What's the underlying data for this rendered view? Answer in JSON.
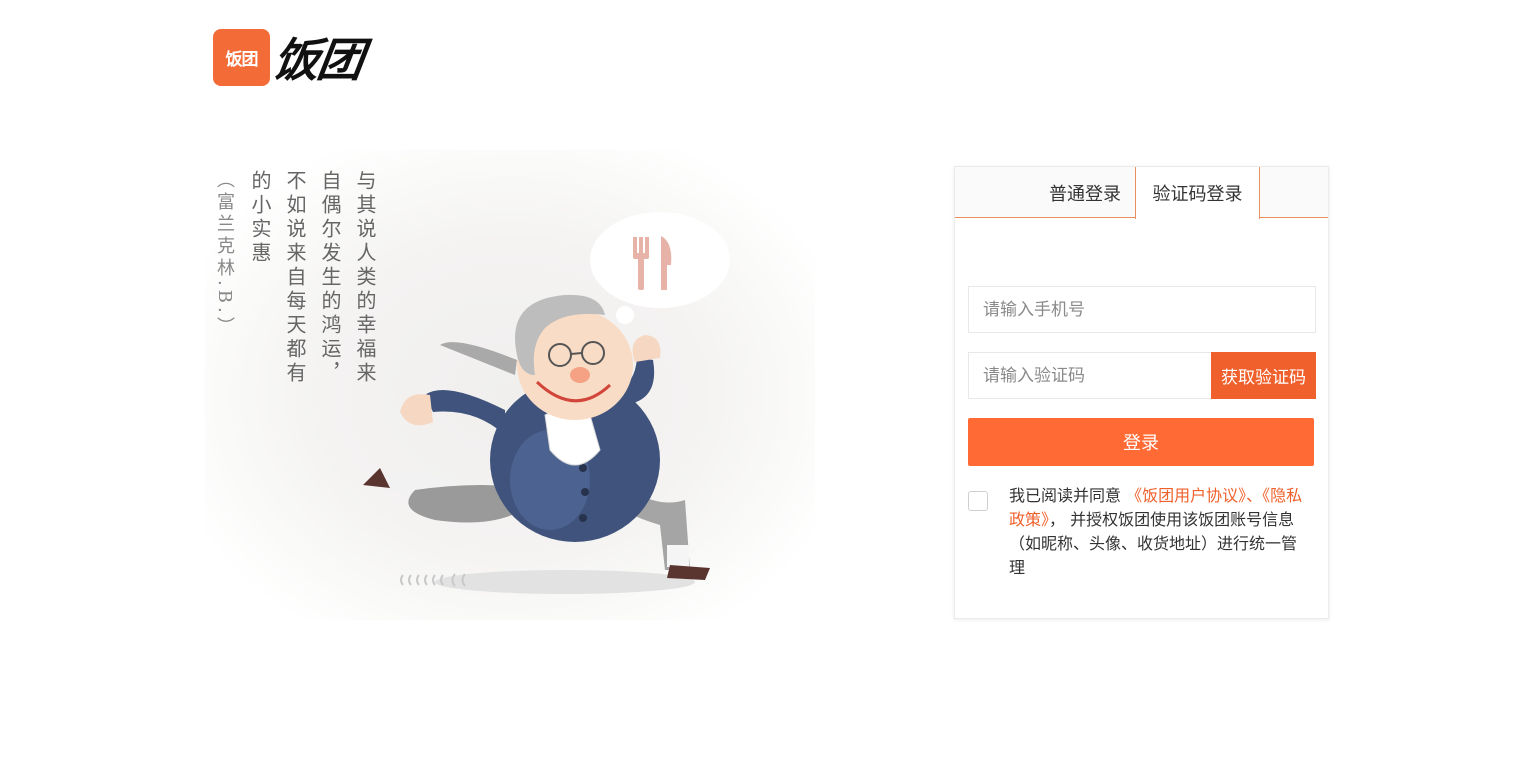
{
  "logo": {
    "badge_text": "饭团",
    "brand_text": "饭团",
    "brand_color": "#f36b36"
  },
  "illustration": {
    "quote_lines": [
      "与其说人类的幸福来",
      "自偶尔发生的鸿运，",
      "不如说来自每天都有",
      "的小实惠"
    ],
    "quote_highlight_color": "#b4442e",
    "attribution": "（富兰克林.B.）",
    "bubble_icon": "fork-knife-icon"
  },
  "login": {
    "tabs": [
      {
        "label": "普通登录",
        "active": false
      },
      {
        "label": "验证码登录",
        "active": true
      }
    ],
    "phone_placeholder": "请输入手机号",
    "code_placeholder": "请输入验证码",
    "get_code_label": "获取验证码",
    "submit_label": "登录",
    "accent_color": "#ff6a35",
    "agreement": {
      "prefix": "我已阅读并同意 ",
      "user_agreement": "《饭团用户协议》",
      "separator": "、",
      "privacy_policy": "《隐私政策》",
      "suffix": "， 并授权饭团使用该饭团账号信息（如昵称、头像、收货地址）进行统一管理",
      "checked": false
    }
  }
}
